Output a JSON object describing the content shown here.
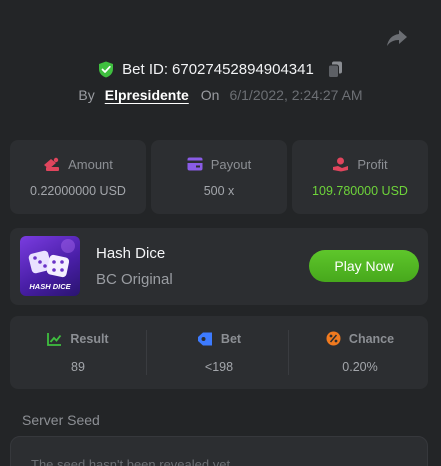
{
  "header": {
    "bet_id_label": "Bet ID:",
    "bet_id": "67027452894904341",
    "by_label": "By",
    "username": "Elpresidente",
    "on_label": "On",
    "date": "6/1/2022, 2:24:27 AM"
  },
  "stats": {
    "amount": {
      "label": "Amount",
      "value": "0.22000000 USD"
    },
    "payout": {
      "label": "Payout",
      "value": "500 x"
    },
    "profit": {
      "label": "Profit",
      "value": "109.780000 USD"
    }
  },
  "game": {
    "title": "Hash Dice",
    "subtitle": "BC Original",
    "thumb_text": "HASH DICE",
    "play_label": "Play Now"
  },
  "result": {
    "result": {
      "label": "Result",
      "value": "89"
    },
    "bet": {
      "label": "Bet",
      "value": "<198"
    },
    "chance": {
      "label": "Chance",
      "value": "0.20%"
    }
  },
  "seed": {
    "label": "Server Seed",
    "text": "The seed hasn't been revealed yet"
  },
  "colors": {
    "background": "#232527",
    "card": "#2c2e31",
    "accent_green": "#5ec62b",
    "profit_green": "#6ed43a"
  },
  "icons": {
    "share": "share-icon",
    "verified": "shield-check-icon",
    "copy": "copy-icon",
    "amount": "amount-icon",
    "payout": "payout-icon",
    "profit": "profit-icon",
    "result": "result-icon",
    "bet": "bet-icon",
    "chance": "percent-icon"
  }
}
